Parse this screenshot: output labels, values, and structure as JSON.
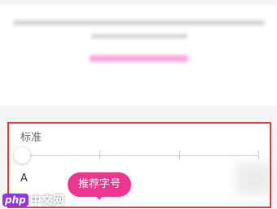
{
  "settings_panel": {
    "title_label": "标准",
    "slider_small_label": "A",
    "recommend_label": "推荐字号",
    "slider_tick_count": 4,
    "selected_position": 0
  },
  "watermark": {
    "logo_text": "php",
    "site_text": "中文网"
  },
  "colors": {
    "accent": "#f0358f",
    "highlight_border": "#e8393f",
    "label_text": "#666666"
  }
}
